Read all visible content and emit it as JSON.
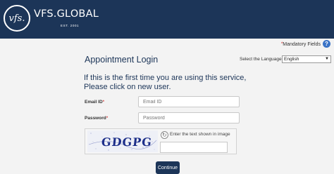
{
  "header": {
    "logo_mark": "vfs.",
    "brand_name": "VFS.GLOBAL",
    "brand_tagline": "EST. 2001"
  },
  "mandatory": {
    "asterisk": "*",
    "label": "Mandatory Fields",
    "help_glyph": "?"
  },
  "page_title": "Appointment Login",
  "language": {
    "label": "Select the Language",
    "selected": "English"
  },
  "intro_text": "If this is the first time you are using this service, Please click on new user.",
  "form": {
    "email_label": "Email ID",
    "email_required": "*",
    "email_placeholder": "Email ID",
    "password_label": "Password",
    "password_required": "*",
    "password_placeholder": "Password"
  },
  "captcha": {
    "image_text": "GDGPG",
    "hint": "Enter the text shown in image",
    "refresh_icon": "refresh-icon"
  },
  "continue_label": "Continue",
  "colors": {
    "header_bg": "#1c3558",
    "accent": "#1c3558",
    "required": "#cc0000"
  }
}
